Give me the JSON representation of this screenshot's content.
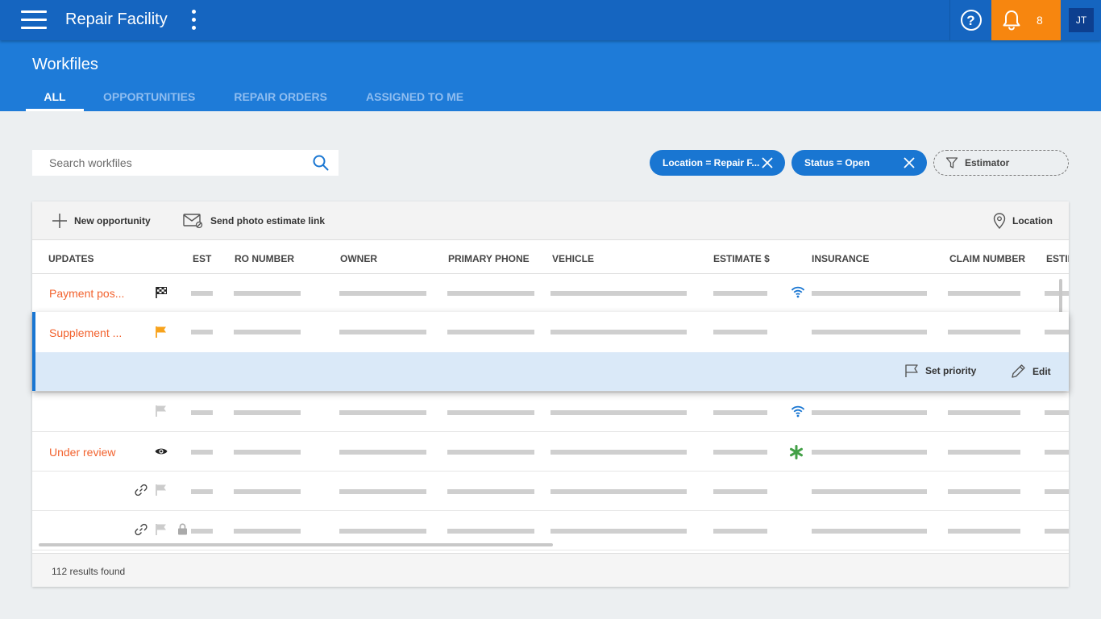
{
  "topbar": {
    "app_title": "Repair Facility",
    "notification_count": "8",
    "user_initials": "JT",
    "help_symbol": "?"
  },
  "header": {
    "page_title": "Workfiles",
    "tabs": [
      {
        "label": "ALL",
        "active": true
      },
      {
        "label": "OPPORTUNITIES",
        "active": false
      },
      {
        "label": "REPAIR ORDERS",
        "active": false
      },
      {
        "label": "ASSIGNED TO ME",
        "active": false
      }
    ]
  },
  "search": {
    "placeholder": "Search workfiles",
    "value": ""
  },
  "filters": {
    "location_chip": "Location = Repair F...",
    "status_chip": "Status = Open",
    "estimator_chip": "Estimator"
  },
  "toolbar": {
    "new_opportunity": "New opportunity",
    "send_photo_link": "Send photo estimate link",
    "location": "Location"
  },
  "table": {
    "columns": [
      "UPDATES",
      "EST",
      "RO NUMBER",
      "OWNER",
      "PRIMARY PHONE",
      "VEHICLE",
      "ESTIMATE $",
      "INSURANCE",
      "CLAIM NUMBER",
      "ESTIMATOR"
    ],
    "rows": [
      {
        "update": "Payment pos...",
        "flag_icon": "checkered-flag-icon",
        "insurance_icon": "wifi-icon"
      },
      {
        "update": "Supplement ...",
        "flag_icon": "orange-flag-icon",
        "insurance_icon": "",
        "expanded": true
      },
      {
        "update": "",
        "flag_icon": "grey-flag-icon",
        "insurance_icon": "wifi-icon"
      },
      {
        "update": "Under review",
        "flag_icon": "eye-icon",
        "insurance_icon": "asterisk-icon"
      },
      {
        "update": "",
        "flag_icon": "grey-flag-icon",
        "link_icon": true,
        "insurance_icon": ""
      },
      {
        "update": "",
        "flag_icon": "grey-flag-icon",
        "link_icon": true,
        "lock_icon": true,
        "insurance_icon": ""
      }
    ]
  },
  "row_actions": {
    "set_priority": "Set priority",
    "edit": "Edit"
  },
  "footer": {
    "results": "112 results found"
  },
  "colors": {
    "topbar": "#1565c0",
    "subheader": "#1e7bd8",
    "accent": "#1976d2",
    "notification": "#f7860f",
    "update_text": "#f2622e",
    "expanded_actions_bg": "#dae9f8",
    "asterisk": "#43a047"
  }
}
